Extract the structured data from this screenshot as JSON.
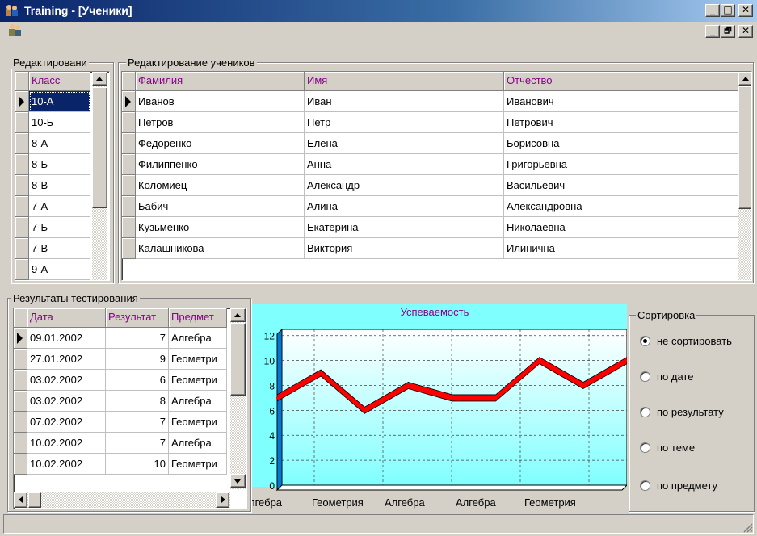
{
  "window": {
    "title": "Training - [Ученики]",
    "buttons": [
      "_",
      "□",
      "✕"
    ],
    "mdi_buttons": [
      "_",
      "🗗",
      "✕"
    ]
  },
  "classes_panel": {
    "label": "Редактировани",
    "header": "Класс",
    "items": [
      "10-А",
      "10-Б",
      "8-А",
      "8-Б",
      "8-В",
      "7-А",
      "7-Б",
      "7-В",
      "9-А"
    ],
    "selected_index": 0
  },
  "students_panel": {
    "label": "Редактирование учеников",
    "headers": [
      "Фамилия",
      "Имя",
      "Отчество"
    ],
    "rows": [
      [
        "Иванов",
        "Иван",
        "Иванович"
      ],
      [
        "Петров",
        "Петр",
        "Петрович"
      ],
      [
        "Федоренко",
        "Елена",
        "Борисовна"
      ],
      [
        "Филиппенко",
        "Анна",
        "Григорьевна"
      ],
      [
        "Коломиец",
        "Александр",
        "Васильевич"
      ],
      [
        "Бабич",
        "Алина",
        "Александровна"
      ],
      [
        "Кузьменко",
        "Екатерина",
        "Николаевна"
      ],
      [
        "Калашникова",
        "Виктория",
        "Илинична"
      ]
    ]
  },
  "results_panel": {
    "label": "Результаты тестирования",
    "headers": [
      "Дата",
      "Результат",
      "Предмет"
    ],
    "rows": [
      [
        "09.01.2002",
        "7",
        "Алгебра"
      ],
      [
        "27.01.2002",
        "9",
        "Геометри"
      ],
      [
        "03.02.2002",
        "6",
        "Геометри"
      ],
      [
        "03.02.2002",
        "8",
        "Алгебра"
      ],
      [
        "07.02.2002",
        "7",
        "Геометри"
      ],
      [
        "10.02.2002",
        "7",
        "Алгебра"
      ],
      [
        "10.02.2002",
        "10",
        "Геометри"
      ]
    ]
  },
  "sort_panel": {
    "label": "Сортировка",
    "options": [
      "не сортировать",
      "по дате",
      "по результату",
      "по теме",
      "по предмету"
    ],
    "selected_index": 0
  },
  "chart_data": {
    "type": "line",
    "title": "Успеваемость",
    "x_tick_labels": [
      "лгебра",
      "Геометрия",
      "Алгебра",
      "Алгебра",
      "Геометрия"
    ],
    "y_ticks": [
      0,
      2,
      4,
      6,
      8,
      10,
      12
    ],
    "ylim": [
      0,
      12.5
    ],
    "grid": true,
    "series": [
      {
        "values": [
          7,
          9,
          6,
          8,
          7,
          7,
          10,
          8,
          10
        ],
        "color": "#ff0000"
      }
    ],
    "colors": {
      "background_top": "#ffffff",
      "background_bottom": "#80ffff",
      "wall": "#0078d7",
      "line": "#ff0000"
    }
  }
}
